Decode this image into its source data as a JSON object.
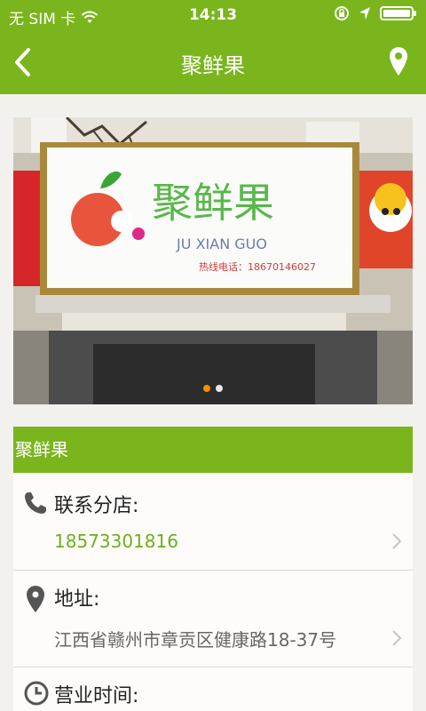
{
  "status_bar": {
    "carrier": "无 SIM 卡",
    "time": "14:13"
  },
  "nav": {
    "title": "聚鲜果"
  },
  "banner": {
    "sign_chinese": "聚鲜果",
    "sign_pinyin": "JU XIAN GUO",
    "sign_hotline": "热线电话：18670146027",
    "carousel_pages": 2,
    "active_page": 1
  },
  "store": {
    "name": "聚鲜果"
  },
  "contact": {
    "label": "联系分店:",
    "phone": "18573301816"
  },
  "address": {
    "label": "地址:",
    "value": "江西省赣州市章贡区健康路18-37号"
  },
  "hours": {
    "label": "营业时间:"
  },
  "colors": {
    "brand_green": "#7ab51d",
    "phone_green": "#6fae1b",
    "dot_active": "#ff8a00"
  }
}
